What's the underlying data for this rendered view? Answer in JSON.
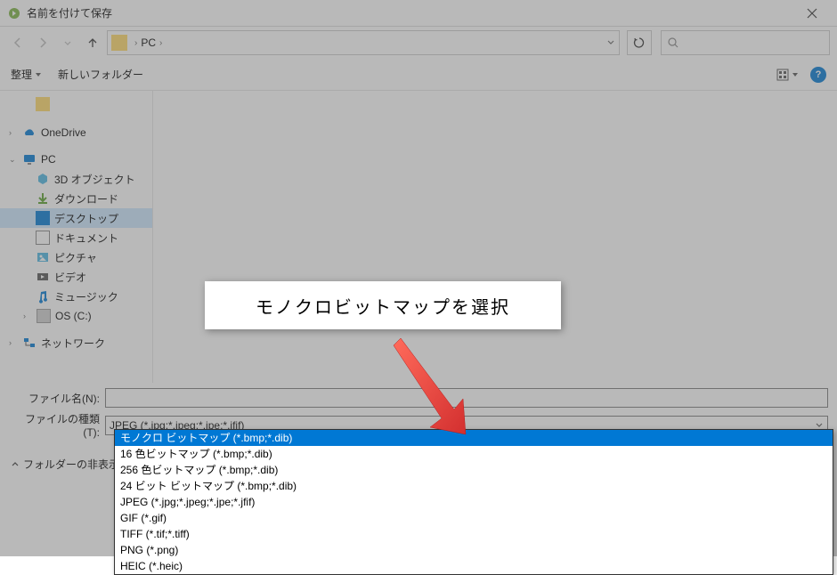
{
  "titlebar": {
    "title": "名前を付けて保存"
  },
  "breadcrumb": {
    "location": "PC"
  },
  "toolbar": {
    "organize": "整理",
    "newfolder": "新しいフォルダー"
  },
  "sidebar": {
    "items": [
      {
        "label": "OneDrive",
        "icon": "cloud"
      },
      {
        "label": "PC",
        "icon": "pc"
      },
      {
        "label": "3D オブジェクト",
        "icon": "3d",
        "child": true
      },
      {
        "label": "ダウンロード",
        "icon": "download",
        "child": true
      },
      {
        "label": "デスクトップ",
        "icon": "desktop",
        "child": true,
        "selected": true
      },
      {
        "label": "ドキュメント",
        "icon": "doc",
        "child": true
      },
      {
        "label": "ピクチャ",
        "icon": "pic",
        "child": true
      },
      {
        "label": "ビデオ",
        "icon": "video",
        "child": true
      },
      {
        "label": "ミュージック",
        "icon": "music",
        "child": true
      },
      {
        "label": "OS (C:)",
        "icon": "drive",
        "child": true
      },
      {
        "label": "ネットワーク",
        "icon": "network"
      }
    ]
  },
  "fields": {
    "filename_label": "ファイル名(N):",
    "filename_value": "",
    "filetype_label": "ファイルの種類(T):",
    "filetype_value": "JPEG (*.jpg;*.jpeg;*.jpe;*.jfif)"
  },
  "dropdown": {
    "options": [
      "モノクロ ビットマップ (*.bmp;*.dib)",
      "16 色ビットマップ (*.bmp;*.dib)",
      "256 色ビットマップ (*.bmp;*.dib)",
      "24 ビット ビットマップ (*.bmp;*.dib)",
      "JPEG (*.jpg;*.jpeg;*.jpe;*.jfif)",
      "GIF (*.gif)",
      "TIFF (*.tif;*.tiff)",
      "PNG (*.png)",
      "HEIC (*.heic)"
    ],
    "highlighted_index": 0
  },
  "footer": {
    "folder_toggle": "フォルダーの非表示"
  },
  "callout": {
    "text": "モノクロビットマップを選択"
  }
}
